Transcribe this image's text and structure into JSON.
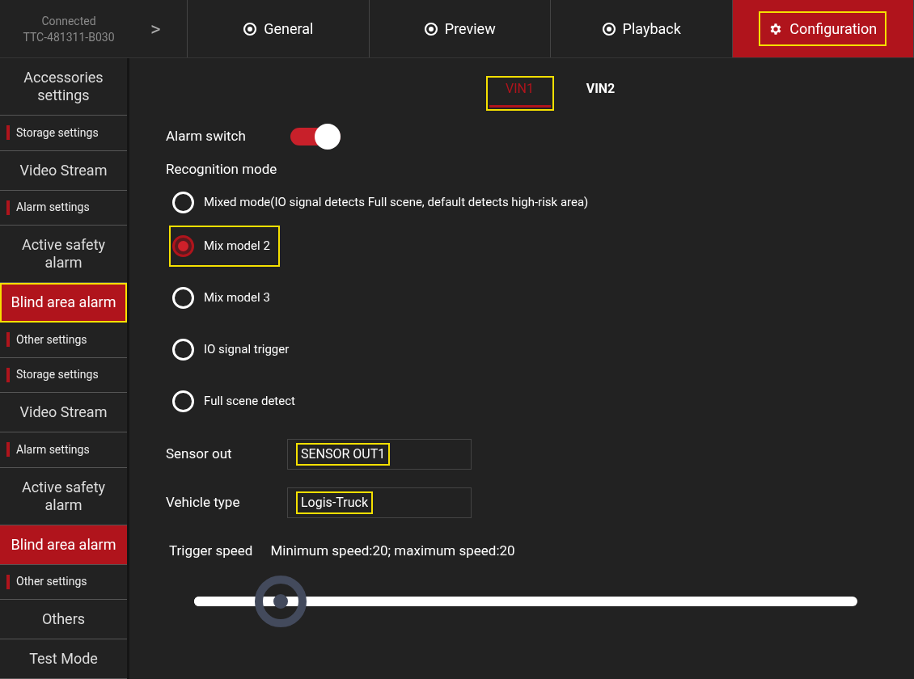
{
  "device": {
    "status": "Connected",
    "id": "TTC-481311-B030",
    "arrow": ">"
  },
  "tabs": [
    {
      "label": "General",
      "selected": false,
      "highlighted": false
    },
    {
      "label": "Preview",
      "selected": false,
      "highlighted": false
    },
    {
      "label": "Playback",
      "selected": false,
      "highlighted": false
    },
    {
      "label": "Configuration",
      "selected": true,
      "highlighted": true
    }
  ],
  "sidebar": {
    "items": [
      {
        "kind": "group",
        "label": "Accessories settings",
        "selected": false,
        "highlighted": false
      },
      {
        "kind": "sub",
        "label": "Storage settings",
        "selected": false,
        "highlighted": false
      },
      {
        "kind": "group",
        "label": "Video Stream",
        "selected": false,
        "highlighted": false
      },
      {
        "kind": "sub",
        "label": "Alarm settings",
        "selected": false,
        "highlighted": false
      },
      {
        "kind": "group",
        "label": "Active safety alarm",
        "selected": false,
        "highlighted": false
      },
      {
        "kind": "group",
        "label": "Blind area alarm",
        "selected": true,
        "highlighted": true
      },
      {
        "kind": "sub",
        "label": "Other settings",
        "selected": false,
        "highlighted": false
      },
      {
        "kind": "sub",
        "label": "Storage settings",
        "selected": false,
        "highlighted": false
      },
      {
        "kind": "group",
        "label": "Video Stream",
        "selected": false,
        "highlighted": false
      },
      {
        "kind": "sub",
        "label": "Alarm settings",
        "selected": false,
        "highlighted": false
      },
      {
        "kind": "group",
        "label": "Active safety alarm",
        "selected": false,
        "highlighted": false
      },
      {
        "kind": "group",
        "label": "Blind area alarm",
        "selected": true,
        "highlighted": false
      },
      {
        "kind": "sub",
        "label": "Other settings",
        "selected": false,
        "highlighted": false
      },
      {
        "kind": "group",
        "label": "Others",
        "selected": false,
        "highlighted": false
      },
      {
        "kind": "group",
        "label": "Test Mode",
        "selected": false,
        "highlighted": false
      }
    ]
  },
  "channels": [
    {
      "label": "VIN1",
      "selected": true,
      "highlighted": true
    },
    {
      "label": "VIN2",
      "selected": false,
      "highlighted": false
    }
  ],
  "alarm_switch": {
    "label": "Alarm switch",
    "on": true
  },
  "recognition": {
    "label": "Recognition mode",
    "options": [
      {
        "label": "Mixed mode(IO signal detects Full scene, default detects high-risk area)",
        "selected": false,
        "highlighted": false
      },
      {
        "label": "Mix model 2",
        "selected": true,
        "highlighted": true
      },
      {
        "label": "Mix model 3",
        "selected": false,
        "highlighted": false
      },
      {
        "label": "IO signal trigger",
        "selected": false,
        "highlighted": false
      },
      {
        "label": "Full scene detect",
        "selected": false,
        "highlighted": false
      }
    ]
  },
  "fields": [
    {
      "label": "Sensor out",
      "value": "SENSOR OUT1",
      "highlighted": true
    },
    {
      "label": "Vehicle type",
      "value": "Logis-Truck",
      "highlighted": true
    }
  ],
  "trigger_speed": {
    "label": "Trigger speed",
    "reading": "Minimum speed:20; maximum speed:20",
    "level": 0.13
  }
}
